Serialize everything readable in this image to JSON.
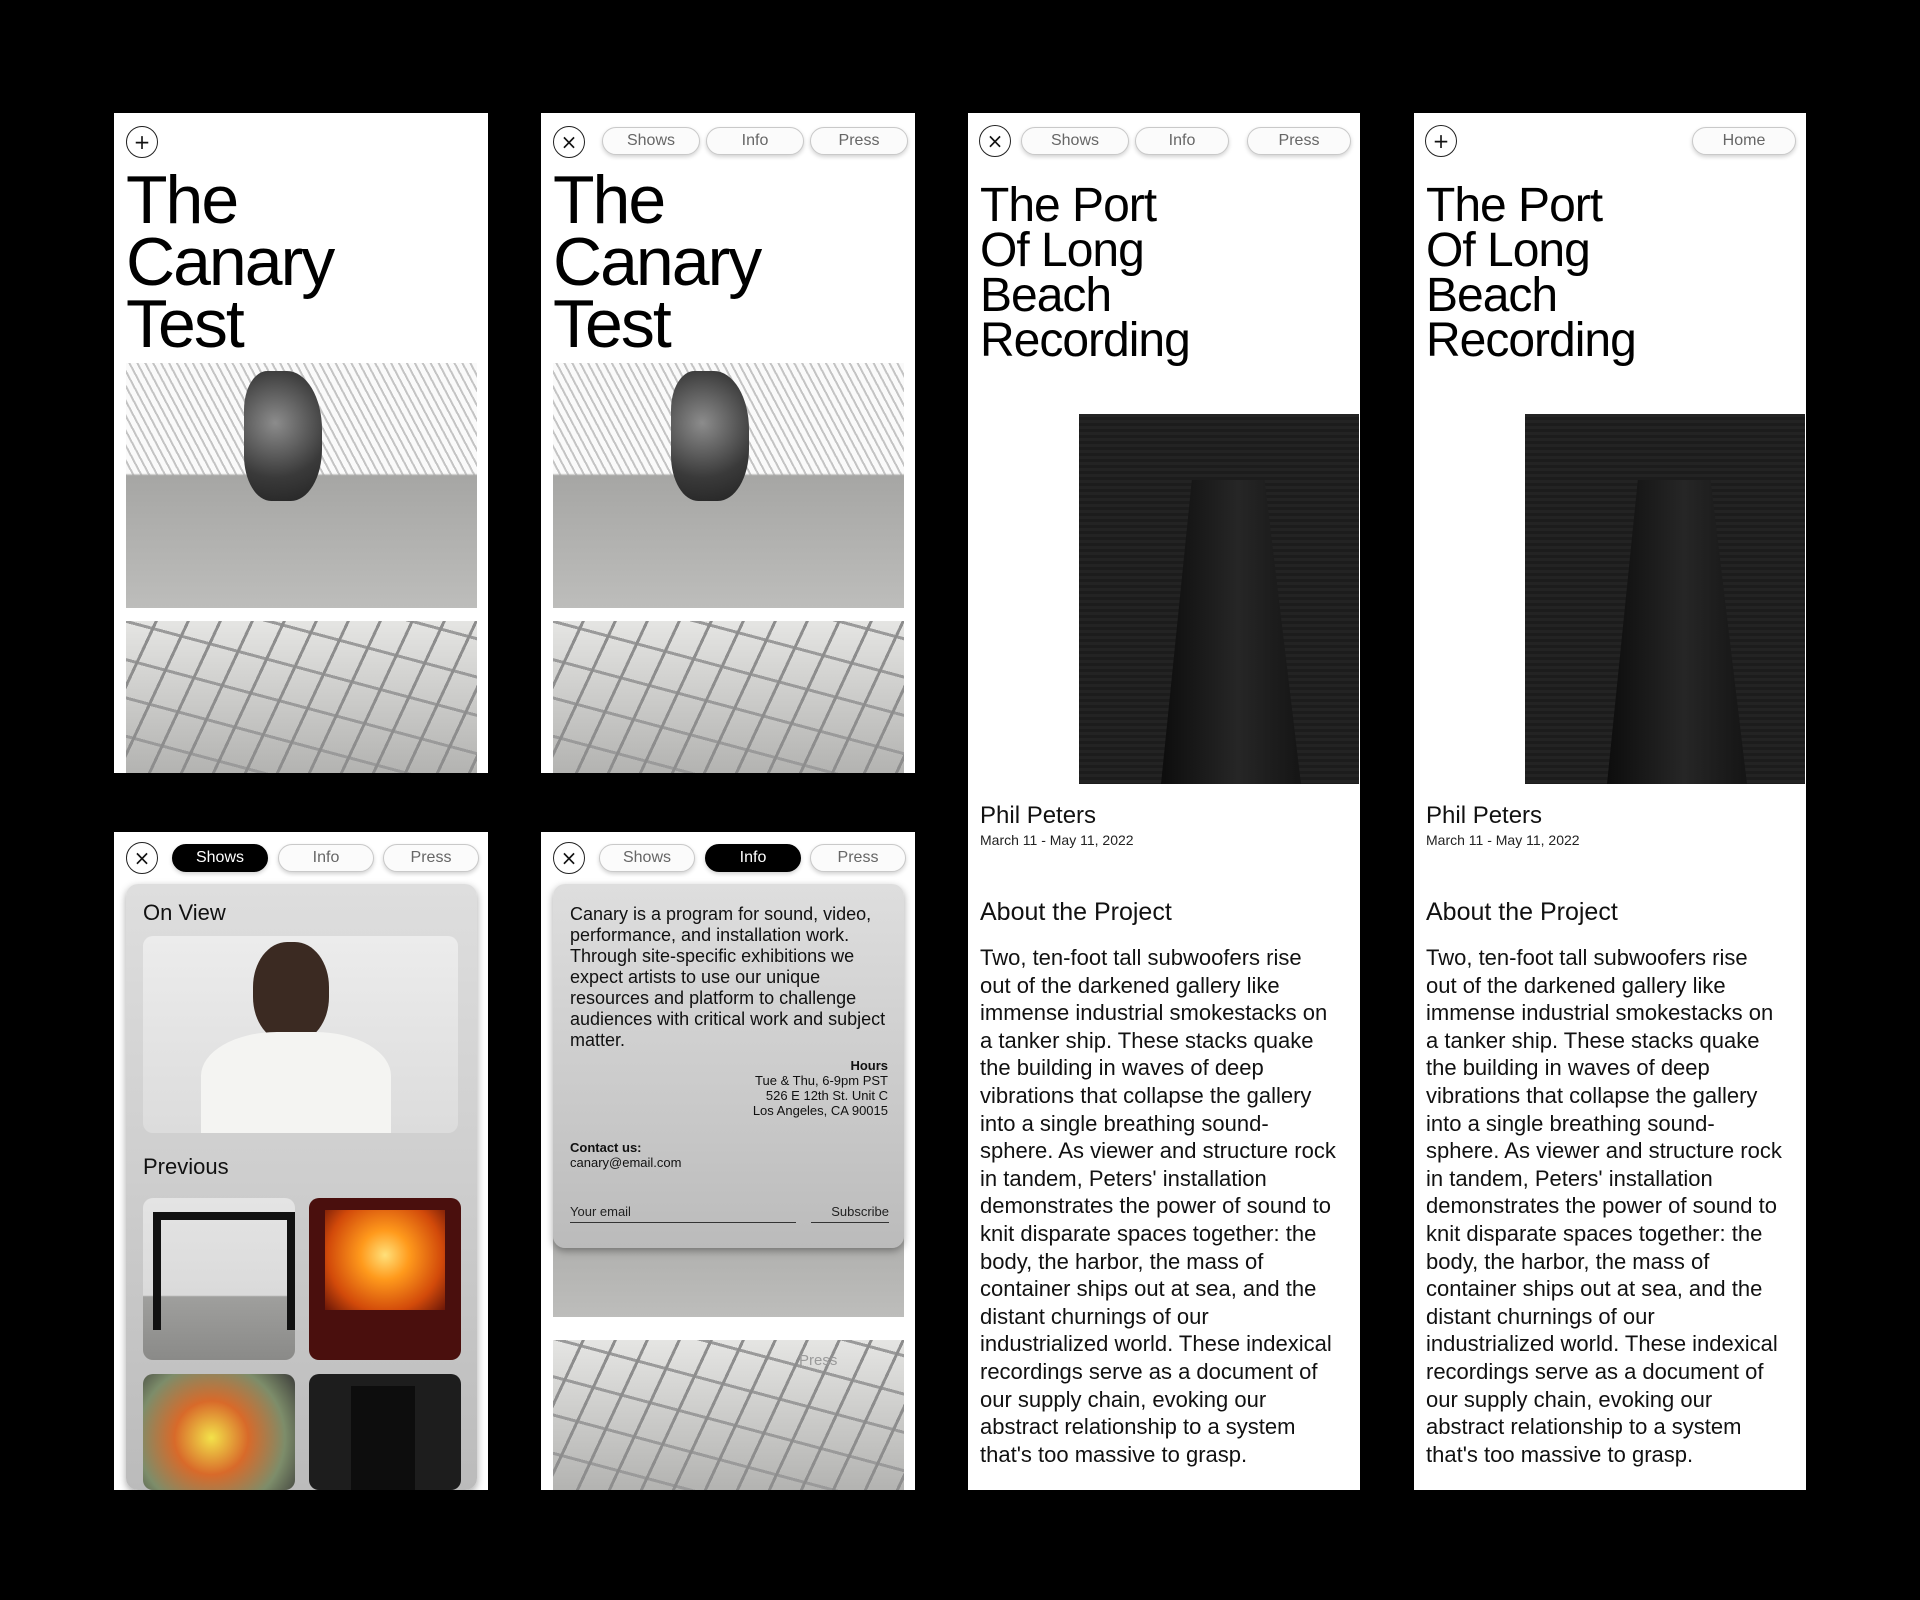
{
  "nav": {
    "shows": "Shows",
    "info": "Info",
    "press": "Press",
    "home": "Home"
  },
  "canary": {
    "title_lines": [
      "The",
      "Canary",
      "Test"
    ]
  },
  "shows_panel": {
    "on_view": "On View",
    "previous": "Previous"
  },
  "info_panel": {
    "description": "Canary is a program for sound, video, performance, and installation work. Through site-specific exhibitions we expect artists to use our unique resources and platform to challenge audiences with critical work and subject matter.",
    "hours_label": "Hours",
    "hours_lines": [
      "Tue & Thu, 6-9pm PST",
      "526 E 12th St. Unit C",
      "Los Angeles, CA 90015"
    ],
    "contact_label": "Contact us:",
    "contact_email": "canary@email.com",
    "email_placeholder": "Your email",
    "subscribe": "Subscribe",
    "press_ghost": "Press"
  },
  "project": {
    "title_lines": [
      "The Port",
      "Of Long",
      "Beach",
      "Recording"
    ],
    "artist": "Phil Peters",
    "dates": "March 11 - May 11, 2022",
    "about_heading": "About the Project",
    "about_lines": [
      "Two, ten-foot tall subwoofers rise",
      "out of the darkened gallery like",
      "immense industrial smokestacks on",
      "a tanker ship. These stacks quake",
      "the building in waves of deep",
      "vibrations that collapse the gallery",
      "into a single breathing sound-",
      "sphere. As viewer and structure rock",
      "in tandem, Peters' installation",
      "demonstrates the power of sound to",
      "knit disparate spaces together: the",
      "body, the harbor, the mass of",
      "container ships out at sea, and the",
      "distant churnings of our",
      "industrialized world. These indexical",
      "recordings serve as a document of",
      "our supply chain, evoking our",
      "abstract relationship to a system",
      "that's too massive to grasp."
    ]
  },
  "icons": {
    "plus": "plus-icon",
    "close": "close-icon"
  },
  "colors": {
    "background": "#000000",
    "screen": "#ffffff",
    "active_pill": "#000000"
  }
}
